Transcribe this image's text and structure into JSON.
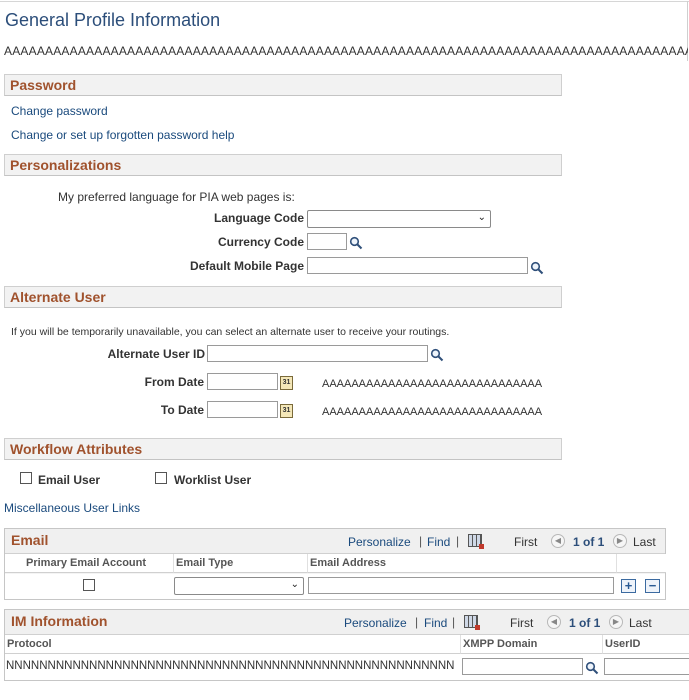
{
  "page": {
    "title": "General Profile Information",
    "aaa_line": "AAAAAAAAAAAAAAAAAAAAAAAAAAAAAAAAAAAAAAAAAAAAAAAAAAAAAAAAAAAAAAAAAAAAAAAAAAAAAAAAAAAAAAAAAAAAAAAAAAAA"
  },
  "password": {
    "header": "Password",
    "change_password": "Change password",
    "forgotten_help": "Change or set up forgotten password help"
  },
  "personalizations": {
    "header": "Personalizations",
    "intro": "My preferred language for PIA web pages is:",
    "language_label": "Language Code",
    "language_value": "",
    "currency_label": "Currency Code",
    "currency_value": "",
    "mobile_label": "Default Mobile Page",
    "mobile_value": ""
  },
  "alternate_user": {
    "header": "Alternate User",
    "intro": "If you will be temporarily unavailable, you can select an alternate user to receive your routings.",
    "user_id_label": "Alternate User ID",
    "from_date_label": "From Date",
    "to_date_label": "To Date",
    "from_date_desc": "AAAAAAAAAAAAAAAAAAAAAAAAAAAAAA",
    "to_date_desc": "AAAAAAAAAAAAAAAAAAAAAAAAAAAAAA"
  },
  "workflow": {
    "header": "Workflow Attributes",
    "email_user": "Email User",
    "worklist_user": "Worklist User",
    "email_user_checked": false,
    "worklist_user_checked": false
  },
  "misc_link": "Miscellaneous User Links",
  "email_grid": {
    "title": "Email",
    "personalize": "Personalize",
    "find": "Find",
    "first": "First",
    "range": "1 of 1",
    "last": "Last",
    "columns": [
      "Primary Email Account",
      "Email Type",
      "Email Address"
    ],
    "row": {
      "primary": false,
      "type": "",
      "address": ""
    }
  },
  "im_grid": {
    "title": "IM Information",
    "personalize": "Personalize",
    "find": "Find",
    "first": "First",
    "range": "1 of 1",
    "last": "Last",
    "columns": [
      "Protocol",
      "XMPP Domain",
      "UserID"
    ],
    "row": {
      "protocol": "NNNNNNNNNNNNNNNNNNNNNNNNNNNNNNNNNNNNNNNNNNNNNNNNNNNNNN",
      "domain": "",
      "userid": ""
    }
  },
  "icons": {
    "lookup": "magnifier-icon",
    "calendar": "calendar-icon",
    "prev": "arrow-left-icon",
    "next": "arrow-right-icon",
    "grid_view": "spreadsheet-icon",
    "add": "plus-icon",
    "remove": "minus-icon"
  },
  "colors": {
    "title": "#2c4e7a",
    "section_text": "#a0522d",
    "link": "#1a4a7d",
    "section_bg": "#f2f2f2"
  }
}
